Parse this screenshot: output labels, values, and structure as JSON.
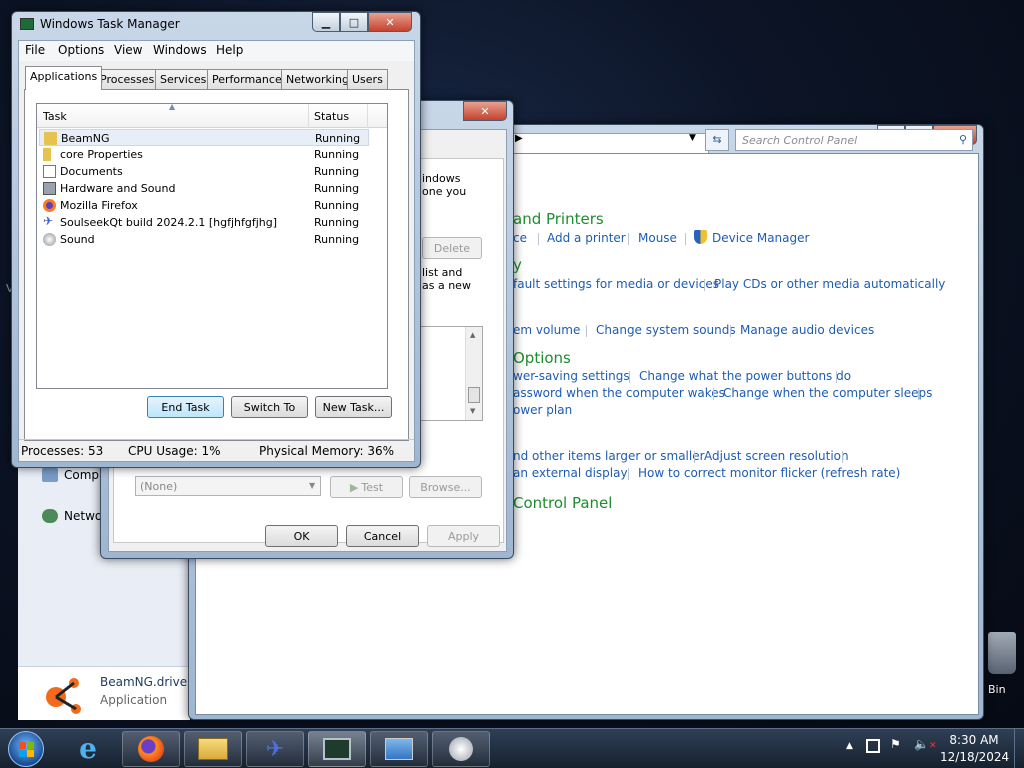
{
  "desktop": {
    "edge_letter": "V",
    "recycle_bin_label": "Bin"
  },
  "control_panel": {
    "search_placeholder": "Search Control Panel",
    "sections": [
      {
        "title": "and Printers",
        "links": [
          "ce",
          "Add a printer",
          "Mouse",
          "Device Manager"
        ]
      },
      {
        "title": "y",
        "links": [
          "fault settings for media or devices",
          "Play CDs or other media automatically"
        ]
      },
      {
        "title": "",
        "links": [
          "em volume",
          "Change system sounds",
          "Manage audio devices"
        ]
      },
      {
        "title": "Options",
        "links": [
          "wer-saving settings",
          "Change what the power buttons do",
          "assword when the computer wakes",
          "Change when the computer sleeps",
          "ower plan"
        ]
      },
      {
        "title": "",
        "links": [
          "nd other items larger or smaller",
          "Adjust screen resolution",
          "an external display",
          "How to correct monitor flicker (refresh rate)"
        ]
      },
      {
        "title": "Control Panel",
        "links": []
      }
    ],
    "left_items": [
      "Comp",
      "Netwo"
    ],
    "balloon": {
      "title": "BeamNG.drive.",
      "subtitle": "Application"
    }
  },
  "dialog": {
    "text1": "indows\none you",
    "delete_label": "Delete",
    "text2": "list and\nas a new",
    "combo_value": "(None)",
    "test_label": "Test",
    "browse_label": "Browse...",
    "ok_label": "OK",
    "cancel_label": "Cancel",
    "apply_label": "Apply"
  },
  "task_manager": {
    "title": "Windows Task Manager",
    "menu": [
      "File",
      "Options",
      "View",
      "Windows",
      "Help"
    ],
    "tabs": [
      "Applications",
      "Processes",
      "Services",
      "Performance",
      "Networking",
      "Users"
    ],
    "columns": {
      "task": "Task",
      "status": "Status"
    },
    "rows": [
      {
        "task": "BeamNG",
        "status": "Running",
        "icon": "folder-icon"
      },
      {
        "task": "core Properties",
        "status": "Running",
        "icon": "folder-icon"
      },
      {
        "task": "Documents",
        "status": "Running",
        "icon": "document-icon"
      },
      {
        "task": "Hardware and Sound",
        "status": "Running",
        "icon": "hardware-icon"
      },
      {
        "task": "Mozilla Firefox",
        "status": "Running",
        "icon": "firefox-icon"
      },
      {
        "task": "SoulseekQt build 2024.2.1 [hgfjhfgfjhg]",
        "status": "Running",
        "icon": "soulseek-icon"
      },
      {
        "task": "Sound",
        "status": "Running",
        "icon": "sound-icon"
      }
    ],
    "buttons": {
      "end_task": "End Task",
      "switch_to": "Switch To",
      "new_task": "New Task..."
    },
    "status_bar": {
      "processes": "Processes: 53",
      "cpu": "CPU Usage: 1%",
      "memory": "Physical Memory: 36%"
    }
  },
  "taskbar": {
    "time": "8:30 AM",
    "date": "12/18/2024",
    "apps": [
      "internet-explorer-icon",
      "firefox-icon",
      "file-explorer-icon",
      "soulseek-icon",
      "task-manager-icon",
      "control-panel-icon",
      "sound-icon"
    ]
  }
}
